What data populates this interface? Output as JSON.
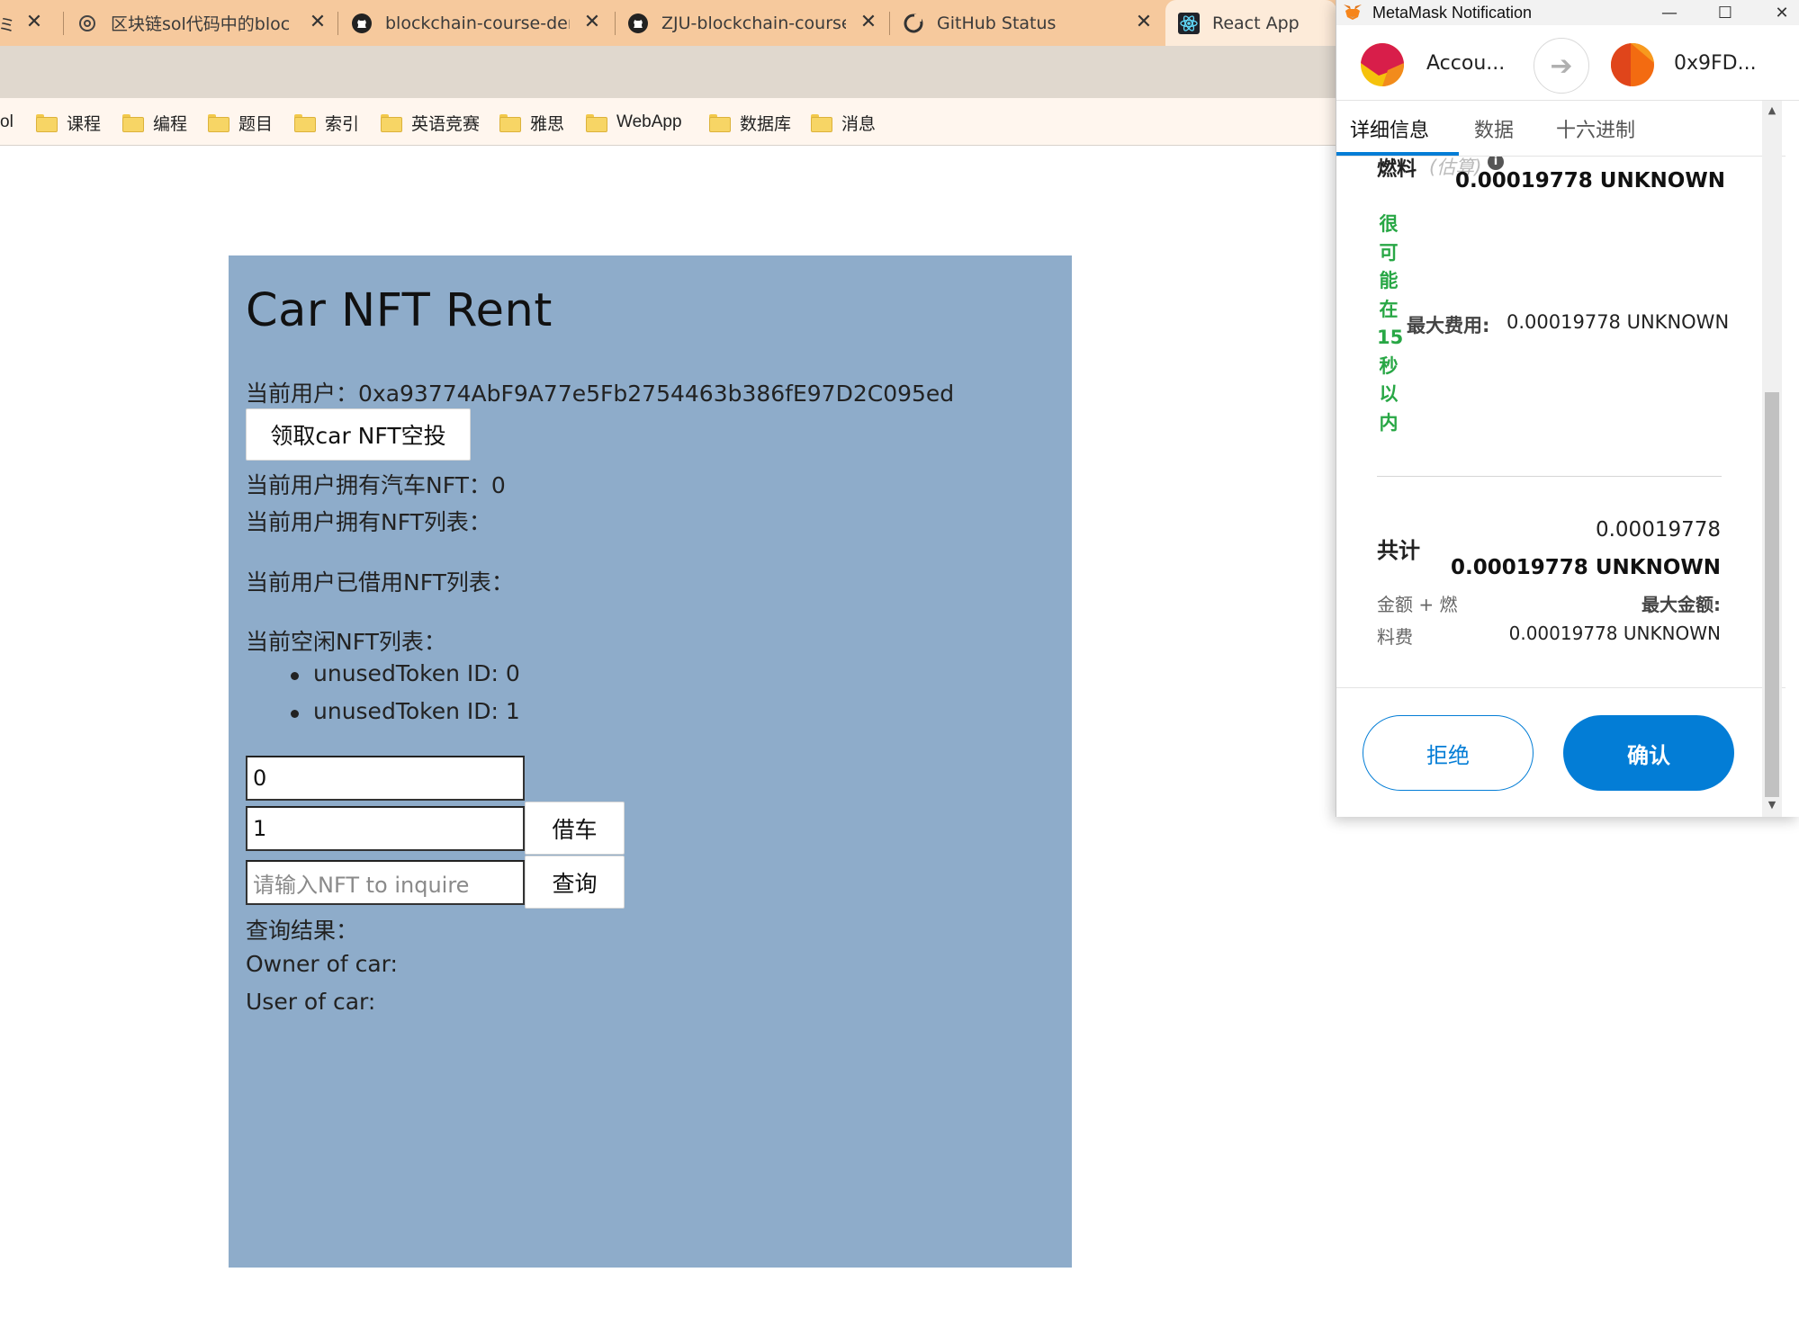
{
  "browser": {
    "tabs": [
      {
        "title": "区块链sol代码中的block",
        "favicon": "openai-icon"
      },
      {
        "title": "blockchain-course-dem",
        "favicon": "github-icon"
      },
      {
        "title": "ZJU-blockchain-course-",
        "favicon": "github-icon"
      },
      {
        "title": "GitHub Status",
        "favicon": "github-status-icon"
      },
      {
        "title": "React App",
        "favicon": "react-icon"
      }
    ],
    "left_partial_label": "ol",
    "bookmarks": [
      "课程",
      "编程",
      "题目",
      "索引",
      "英语竞赛",
      "雅思",
      "WebApp",
      "数据库",
      "消息"
    ]
  },
  "app": {
    "title": "Car NFT Rent",
    "current_user_label": "当前用户：0xa93774AbF9A77e5Fb2754463b386fE97D2C095ed",
    "airdrop_button": "领取car NFT空投",
    "owned_count_label": "当前用户拥有汽车NFT：0",
    "owned_list_label": "当前用户拥有NFT列表：",
    "borrowed_list_label": "当前用户已借用NFT列表：",
    "free_list_label": "当前空闲NFT列表：",
    "free_items": [
      "unusedToken ID: 0",
      "unusedToken ID: 1"
    ],
    "token_input_value": "0",
    "duration_input_value": "1",
    "borrow_button": "借车",
    "inquire_placeholder": "请输入NFT to inquire",
    "inquire_button": "查询",
    "result_label": "查询结果：",
    "owner_label": "Owner of car:",
    "user_label": "User of car:"
  },
  "metamask": {
    "window_title": "MetaMask Notification",
    "from_account": "Accou...",
    "to_account": "0x9FD...",
    "tabs": [
      "详细信息",
      "数据",
      "十六进制"
    ],
    "gas_label": "燃料",
    "gas_estimate_label": "(估算)",
    "gas_value": "0.00019778 UNKNOWN",
    "likely_label": "很可能在15秒以内",
    "max_fee_label": "最大费用:",
    "max_fee_value": "0.00019778 UNKNOWN",
    "total_label": "共计",
    "total_value_top": "0.00019778",
    "total_value": "0.00019778 UNKNOWN",
    "amount_gas_label_1": "金额 + 燃",
    "amount_gas_label_2": "料费",
    "max_amount_label": "最大金额:",
    "max_amount_value": "0.00019778 UNKNOWN",
    "reject_button": "拒绝",
    "confirm_button": "确认",
    "accent_color": "#037dd6",
    "success_color": "#28a745"
  }
}
